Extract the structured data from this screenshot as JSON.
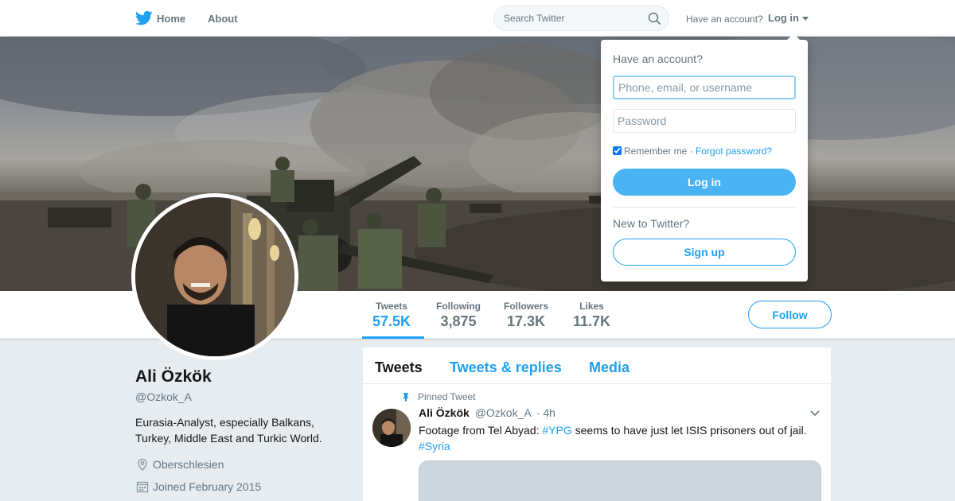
{
  "topbar": {
    "home_label": "Home",
    "about_label": "About",
    "search_placeholder": "Search Twitter",
    "have_account": "Have an account?",
    "login_label": "Log in",
    "brand_color": "#1da1f2"
  },
  "profile": {
    "name": "Ali Özkök",
    "handle": "@Ozkok_A",
    "bio": "Eurasia-Analyst, especially Balkans, Turkey, Middle East and Turkic World.",
    "location": "Oberschlesien",
    "joined": "Joined February 2015"
  },
  "stats": [
    {
      "label": "Tweets",
      "value": "57.5K"
    },
    {
      "label": "Following",
      "value": "3,875"
    },
    {
      "label": "Followers",
      "value": "17.3K"
    },
    {
      "label": "Likes",
      "value": "11.7K"
    }
  ],
  "follow_label": "Follow",
  "timeline": {
    "tabs": [
      "Tweets",
      "Tweets & replies",
      "Media"
    ],
    "tweet": {
      "pinned_label": "Pinned Tweet",
      "author": "Ali Özkök",
      "handle": "@Ozkok_A",
      "time": "· 4h",
      "text_before": "Footage from Tel Abyad: ",
      "hashtag1": "#YPG",
      "text_after": " seems to have just let ISIS prisoners out of jail.",
      "hashtag2": "#Syria"
    }
  },
  "login_dropdown": {
    "title": "Have an account?",
    "username_placeholder": "Phone, email, or username",
    "password_placeholder": "Password",
    "remember_label": "Remember me",
    "separator": " · ",
    "forgot_label": "Forgot password?",
    "login_button": "Log in",
    "new_label": "New to Twitter?",
    "signup_button": "Sign up"
  }
}
